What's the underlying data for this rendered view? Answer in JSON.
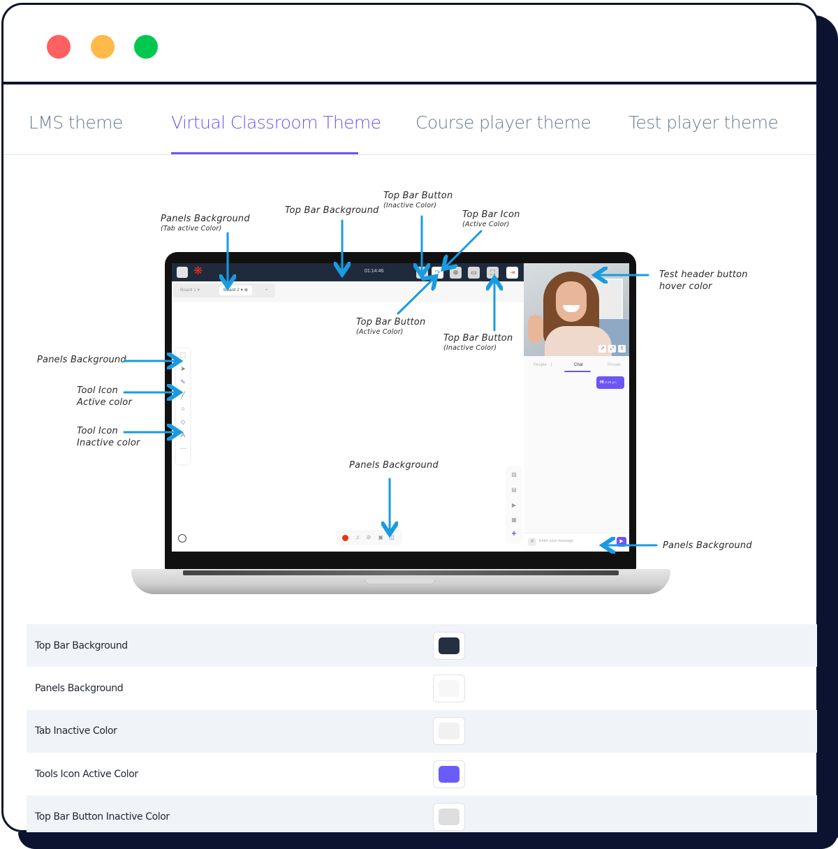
{
  "window": {
    "controls": [
      {
        "name": "close",
        "color": "#ff6060"
      },
      {
        "name": "minimize",
        "color": "#ffb948"
      },
      {
        "name": "maximize",
        "color": "#00c84e"
      }
    ]
  },
  "tabs": [
    {
      "label": "LMS theme",
      "active": false
    },
    {
      "label": "Virtual Classroom Theme",
      "active": true
    },
    {
      "label": "Course player theme",
      "active": false
    },
    {
      "label": "Test player theme",
      "active": false
    }
  ],
  "accent_color": "#6d55f5",
  "illustration": {
    "annotations": {
      "panels_bg_tab": {
        "title": "Panels Background",
        "sub": "(Tab active Color)"
      },
      "top_bar_bg": {
        "title": "Top Bar Background"
      },
      "top_bar_button_inactive_top": {
        "title": "Top Bar Button",
        "sub": "(Inactive Color)"
      },
      "top_bar_icon_active": {
        "title": "Top Bar Icon",
        "sub": "(Active Color)"
      },
      "test_header_hover": {
        "title": "Test header button",
        "title2": "hover color"
      },
      "top_bar_button_active": {
        "title": "Top Bar Button",
        "sub": "(Active Color)"
      },
      "top_bar_button_inactive": {
        "title": "Top Bar Button",
        "sub": "(Inactive Color)"
      },
      "panels_bg_left": {
        "title": "Panels Background"
      },
      "tool_icon_active": {
        "title": "Tool Icon",
        "title2": "Active color"
      },
      "tool_icon_inactive": {
        "title": "Tool Icon",
        "title2": "Inactive color"
      },
      "panels_bg_bottom": {
        "title": "Panels Background"
      },
      "panels_bg_chat": {
        "title": "Panels Background"
      }
    },
    "screen": {
      "timer": "01:14:46",
      "board_tabs": [
        {
          "label": "Board 1 ▾",
          "active": false
        },
        {
          "label": "Board 2 ▾  ⊗",
          "active": true
        }
      ],
      "add_board": "+",
      "chat_tabs": [
        "People · 1",
        "Chat",
        "Private"
      ],
      "chat_message": {
        "text": "Hi",
        "time": "5:29 pm"
      },
      "chat_placeholder": "Enter your message"
    }
  },
  "settings": {
    "rows": [
      {
        "label": "Top Bar Background",
        "color": "#243040"
      },
      {
        "label": "Panels Background",
        "color": "#f7f7f7"
      },
      {
        "label": "Tab Inactive Color",
        "color": "#f1f1f1"
      },
      {
        "label": "Tools Icon Active Color",
        "color": "#6a5cf9"
      },
      {
        "label": "Top Bar Button Inactive Color",
        "color": "#dedede"
      }
    ]
  }
}
